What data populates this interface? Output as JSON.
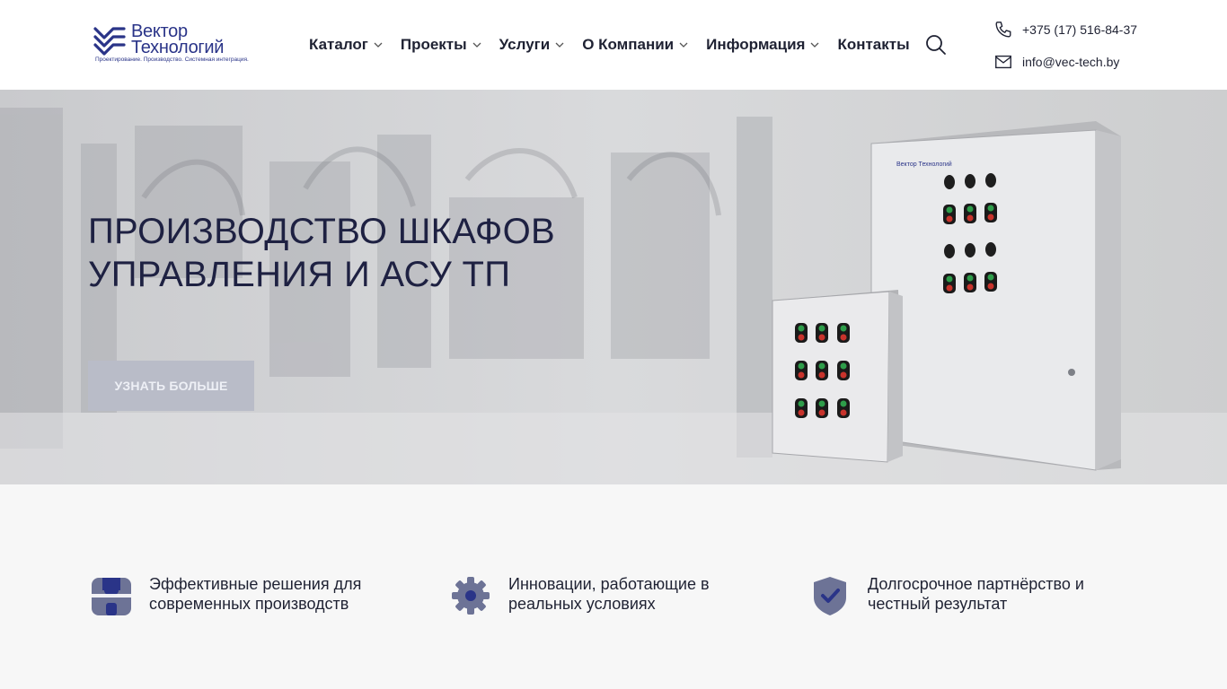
{
  "header": {
    "logo": {
      "name_line1": "Вектор",
      "name_line2": "Технологий",
      "tagline": "Проектирование. Производство. Системная интеграция."
    },
    "nav": [
      {
        "label": "Каталог",
        "has_dropdown": true,
        "icon": "chevron-down-icon"
      },
      {
        "label": "Проекты",
        "has_dropdown": true,
        "icon": "chevron-down-icon"
      },
      {
        "label": "Услуги",
        "has_dropdown": true,
        "icon": "chevron-down-icon"
      },
      {
        "label": "О Компании",
        "has_dropdown": true,
        "icon": "chevron-down-icon"
      },
      {
        "label": "Информация",
        "has_dropdown": true,
        "icon": "chevron-down-icon"
      },
      {
        "label": "Контакты",
        "has_dropdown": false
      }
    ],
    "search_icon": "search-icon",
    "phone": "+375 (17) 516-84-37",
    "email": "info@vec-tech.by"
  },
  "hero": {
    "title_line1": "ПРОИЗВОДСТВО ШКАФОВ",
    "title_line2": "УПРАВЛЕНИЯ И АСУ ТП",
    "button_label": "УЗНАТЬ БОЛЬШЕ",
    "cabinet_brand": "Вектор Технологий"
  },
  "features": [
    {
      "icon": "store-icon",
      "text": "Эффективные решения для современных производств"
    },
    {
      "icon": "gear-icon",
      "text": "Инновации, работающие в реальных условиях"
    },
    {
      "icon": "shield-check-icon",
      "text": "Долгосрочное партнёрство и честный результат"
    }
  ],
  "colors": {
    "brand": "#2a3488",
    "text_dark": "#1e2142",
    "icon_fill": "#6d7396",
    "icon_accent": "#2a3488",
    "button_bg": "#b9bcc8",
    "hero_bg": "#cfd0d3"
  }
}
